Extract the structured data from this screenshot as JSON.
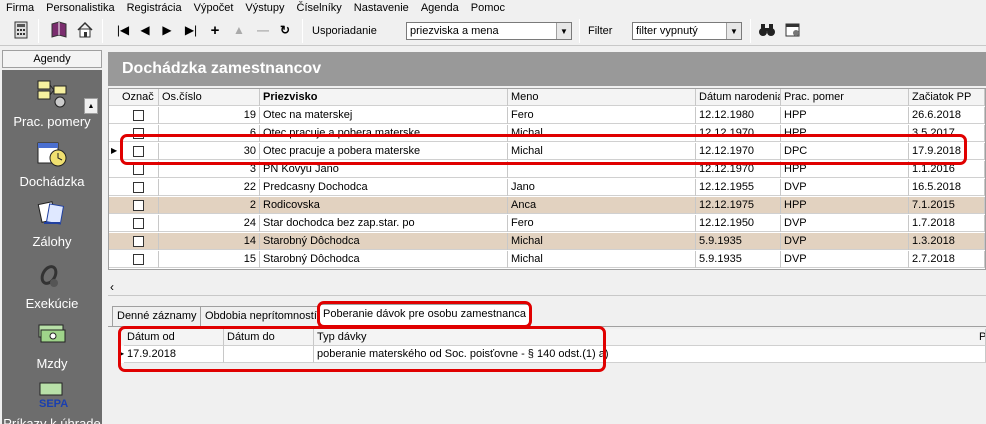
{
  "menu": [
    "Firma",
    "Personalistika",
    "Registrácia",
    "Výpočet",
    "Výstupy",
    "Číselníky",
    "Nastavenie",
    "Agenda",
    "Pomoc"
  ],
  "toolbar": {
    "sort_label": "Usporiadanie",
    "sort_value": "priezviska a mena",
    "filter_label": "Filter",
    "filter_value": "filter vypnutý"
  },
  "sidebar": {
    "header": "Agendy",
    "items": [
      {
        "label": "Prac. pomery",
        "icon": "org-chart-icon"
      },
      {
        "label": "Dochádzka",
        "icon": "calendar-clock-icon"
      },
      {
        "label": "Zálohy",
        "icon": "cards-icon"
      },
      {
        "label": "Exekúcie",
        "icon": "chain-icon"
      },
      {
        "label": "Mzdy",
        "icon": "money-icon"
      },
      {
        "label": "Príkazy k úhrade",
        "icon": "sepa-icon"
      }
    ]
  },
  "main": {
    "title": "Dochádzka zamestnancov",
    "columns": [
      "Označ",
      "Os.číslo",
      "Priezvisko",
      "Meno",
      "Dátum narodenia",
      "Prac. pomer",
      "Začiatok PP"
    ],
    "rows": [
      {
        "id": "19",
        "surname": "Otec na materskej",
        "name": "Fero",
        "birth": "12.12.1980",
        "type": "HPP",
        "start": "26.6.2018",
        "tan": false
      },
      {
        "id": "6",
        "surname": "Otec pracuje a pobera materske",
        "name": "Michal",
        "birth": "12.12.1970",
        "type": "HPP",
        "start": "3.5.2017",
        "tan": false
      },
      {
        "id": "30",
        "surname": "Otec pracuje a pobera materske",
        "name": "Michal",
        "birth": "12.12.1970",
        "type": "DPC",
        "start": "17.9.2018",
        "tan": false,
        "current": true
      },
      {
        "id": "3",
        "surname": "PN Kovyu Jano",
        "name": "",
        "birth": "12.12.1970",
        "type": "HPP",
        "start": "1.1.2016",
        "tan": false
      },
      {
        "id": "22",
        "surname": "Predcasny Dochodca",
        "name": "Jano",
        "birth": "12.12.1955",
        "type": "DVP",
        "start": "16.5.2018",
        "tan": false
      },
      {
        "id": "2",
        "surname": "Rodicovska",
        "name": "Anca",
        "birth": "12.12.1975",
        "type": "HPP",
        "start": "7.1.2015",
        "tan": true
      },
      {
        "id": "24",
        "surname": "Star dochodca bez zap.star. po",
        "name": "Fero",
        "birth": "12.12.1950",
        "type": "DVP",
        "start": "1.7.2018",
        "tan": false
      },
      {
        "id": "14",
        "surname": "Starobný  Dôchodca",
        "name": "Michal",
        "birth": "5.9.1935",
        "type": "DVP",
        "start": "1.3.2018",
        "tan": true
      },
      {
        "id": "15",
        "surname": "Starobný  Dôchodca",
        "name": "Michal",
        "birth": "5.9.1935",
        "type": "DVP",
        "start": "2.7.2018",
        "tan": false
      }
    ]
  },
  "tabs": [
    "Denné záznamy",
    "Obdobia neprítomností",
    "Poberanie dávok pre osobu zamestnanca"
  ],
  "sub": {
    "columns": [
      "Dátum od",
      "Dátum do",
      "Typ dávky",
      "P"
    ],
    "rows": [
      {
        "from": "17.9.2018",
        "to": "",
        "type": "poberanie materského od Soc. poisťovne - § 140 odst.(1) a)"
      }
    ]
  },
  "colors": {
    "highlight": "#e00000",
    "title_bar": "#999999",
    "sidebar_bg": "#6d6d6d",
    "tan_row": "#e2d2c0"
  }
}
